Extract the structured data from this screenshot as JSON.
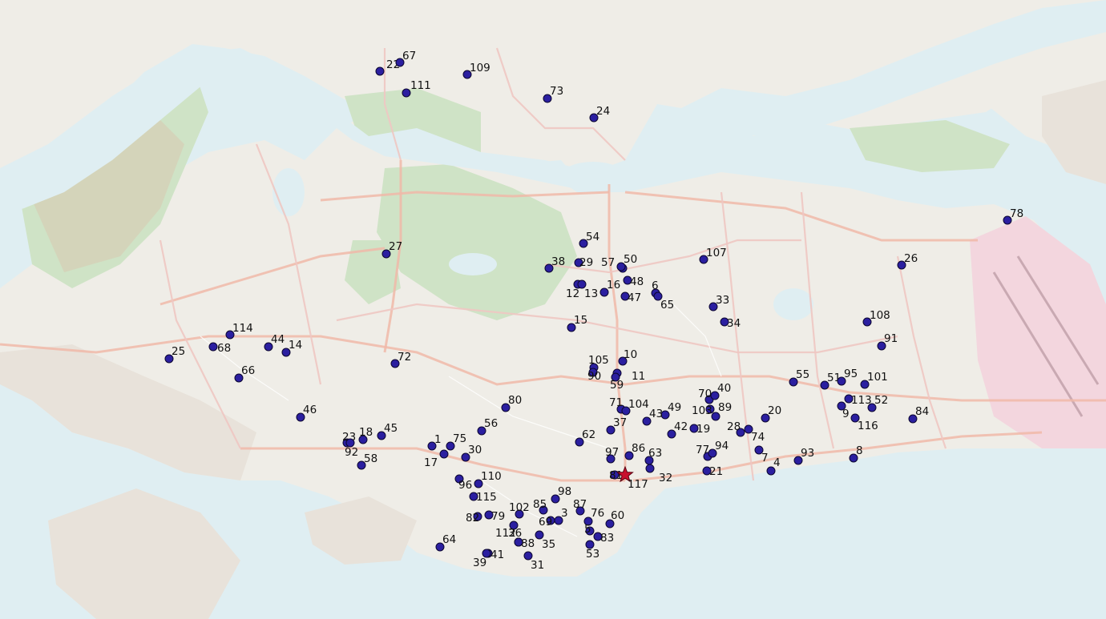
{
  "map": {
    "colors": {
      "water": "#dfeef2",
      "land": "#efede7",
      "park": "#cfe3c6",
      "airport": "#f3d6de",
      "urban": "#e8e2da",
      "point_fill": "#2b1fa0",
      "point_stroke": "#0c0630",
      "star_fill": "#c8102e"
    },
    "basemap": "OpenStreetMap-style light basemap of Singapore",
    "points": [
      {
        "id": "22",
        "type": "point"
      },
      {
        "id": "67",
        "type": "point"
      },
      {
        "id": "109",
        "type": "point"
      },
      {
        "id": "111",
        "type": "point"
      },
      {
        "id": "73",
        "type": "point"
      },
      {
        "id": "24",
        "type": "point"
      },
      {
        "id": "78",
        "type": "point"
      },
      {
        "id": "26",
        "type": "point"
      },
      {
        "id": "54",
        "type": "point"
      },
      {
        "id": "38",
        "type": "point"
      },
      {
        "id": "29",
        "type": "point"
      },
      {
        "id": "57",
        "type": "point"
      },
      {
        "id": "50",
        "type": "point"
      },
      {
        "id": "107",
        "type": "point"
      },
      {
        "id": "12",
        "type": "point"
      },
      {
        "id": "13",
        "type": "point"
      },
      {
        "id": "16",
        "type": "point"
      },
      {
        "id": "48",
        "type": "point"
      },
      {
        "id": "6",
        "type": "point"
      },
      {
        "id": "65",
        "type": "point"
      },
      {
        "id": "47",
        "type": "point"
      },
      {
        "id": "33",
        "type": "point"
      },
      {
        "id": "34",
        "type": "point"
      },
      {
        "id": "27",
        "type": "point"
      },
      {
        "id": "15",
        "type": "point"
      },
      {
        "id": "108",
        "type": "point"
      },
      {
        "id": "91",
        "type": "point"
      },
      {
        "id": "114",
        "type": "point"
      },
      {
        "id": "44",
        "type": "point"
      },
      {
        "id": "14",
        "type": "point"
      },
      {
        "id": "25",
        "type": "point"
      },
      {
        "id": "68",
        "type": "point"
      },
      {
        "id": "66",
        "type": "point"
      },
      {
        "id": "72",
        "type": "point"
      },
      {
        "id": "105",
        "type": "point"
      },
      {
        "id": "10",
        "type": "point"
      },
      {
        "id": "90",
        "type": "point"
      },
      {
        "id": "11",
        "type": "point"
      },
      {
        "id": "59",
        "type": "point"
      },
      {
        "id": "55",
        "type": "point"
      },
      {
        "id": "51",
        "type": "point"
      },
      {
        "id": "95",
        "type": "point"
      },
      {
        "id": "101",
        "type": "point"
      },
      {
        "id": "70",
        "type": "point"
      },
      {
        "id": "40",
        "type": "point"
      },
      {
        "id": "113",
        "type": "point"
      },
      {
        "id": "52",
        "type": "point"
      },
      {
        "id": "80",
        "type": "point"
      },
      {
        "id": "71",
        "type": "point"
      },
      {
        "id": "104",
        "type": "point"
      },
      {
        "id": "49",
        "type": "point"
      },
      {
        "id": "103",
        "type": "point"
      },
      {
        "id": "89",
        "type": "point"
      },
      {
        "id": "9",
        "type": "point"
      },
      {
        "id": "84",
        "type": "point"
      },
      {
        "id": "46",
        "type": "point"
      },
      {
        "id": "43",
        "type": "point"
      },
      {
        "id": "20",
        "type": "point"
      },
      {
        "id": "116",
        "type": "point"
      },
      {
        "id": "56",
        "type": "point"
      },
      {
        "id": "37",
        "type": "point"
      },
      {
        "id": "42",
        "type": "point"
      },
      {
        "id": "19",
        "type": "point"
      },
      {
        "id": "28",
        "type": "point"
      },
      {
        "id": "74",
        "type": "point"
      },
      {
        "id": "23",
        "type": "point"
      },
      {
        "id": "18",
        "type": "point"
      },
      {
        "id": "45",
        "type": "point"
      },
      {
        "id": "62",
        "type": "point"
      },
      {
        "id": "92",
        "type": "point"
      },
      {
        "id": "1",
        "type": "point"
      },
      {
        "id": "75",
        "type": "point"
      },
      {
        "id": "86",
        "type": "point"
      },
      {
        "id": "97",
        "type": "point"
      },
      {
        "id": "63",
        "type": "point"
      },
      {
        "id": "77",
        "type": "point"
      },
      {
        "id": "94",
        "type": "point"
      },
      {
        "id": "7",
        "type": "point"
      },
      {
        "id": "93",
        "type": "point"
      },
      {
        "id": "8",
        "type": "point"
      },
      {
        "id": "58",
        "type": "point"
      },
      {
        "id": "30",
        "type": "point"
      },
      {
        "id": "17",
        "type": "point"
      },
      {
        "id": "4",
        "type": "point"
      },
      {
        "id": "21",
        "type": "point"
      },
      {
        "id": "81",
        "type": "point"
      },
      {
        "id": "117",
        "type": "star"
      },
      {
        "id": "32",
        "type": "point"
      },
      {
        "id": "96",
        "type": "point"
      },
      {
        "id": "110",
        "type": "point"
      },
      {
        "id": "115",
        "type": "point"
      },
      {
        "id": "98",
        "type": "point"
      },
      {
        "id": "85",
        "type": "point"
      },
      {
        "id": "102",
        "type": "point"
      },
      {
        "id": "87",
        "type": "point"
      },
      {
        "id": "3",
        "type": "point"
      },
      {
        "id": "76",
        "type": "point"
      },
      {
        "id": "60",
        "type": "point"
      },
      {
        "id": "82",
        "type": "point"
      },
      {
        "id": "79",
        "type": "point"
      },
      {
        "id": "69",
        "type": "point"
      },
      {
        "id": "36",
        "type": "point"
      },
      {
        "id": "5",
        "type": "point"
      },
      {
        "id": "83",
        "type": "point"
      },
      {
        "id": "112",
        "type": "point"
      },
      {
        "id": "35",
        "type": "point"
      },
      {
        "id": "88",
        "type": "point"
      },
      {
        "id": "64",
        "type": "point"
      },
      {
        "id": "53",
        "type": "point"
      },
      {
        "id": "41",
        "type": "point"
      },
      {
        "id": "39",
        "type": "point"
      },
      {
        "id": "31",
        "type": "point"
      }
    ]
  }
}
